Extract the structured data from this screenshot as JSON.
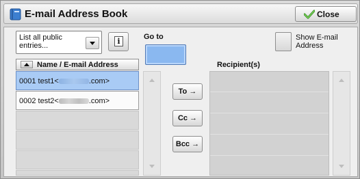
{
  "window": {
    "title": "E-mail Address Book",
    "close_label": "Close"
  },
  "filter": {
    "selected_value": "List all public entries..."
  },
  "goto": {
    "label": "Go to",
    "value": ""
  },
  "show_email": {
    "label": "Show E-mail Address",
    "checked": false
  },
  "list": {
    "column_header": "Name / E-mail Address",
    "sort": "ascending",
    "entries": [
      {
        "number": "0001",
        "name_prefix": "test1<",
        "domain_suffix": ".com>",
        "selected": true
      },
      {
        "number": "0002",
        "name_prefix": "test2<",
        "domain_suffix": ".com>",
        "selected": false
      }
    ]
  },
  "actions": {
    "to_label": "To →",
    "cc_label": "Cc →",
    "bcc_label": "Bcc →"
  },
  "recipients": {
    "header": "Recipient(s)",
    "items": []
  },
  "icons": {
    "title_icon": "address-book-icon",
    "close_icon": "checkmark-icon",
    "info_icon": "info-icon"
  },
  "colors": {
    "selection": "#a9cbf5",
    "goto_field": "#8ab8f0",
    "book_icon": "#3d7fd0"
  }
}
